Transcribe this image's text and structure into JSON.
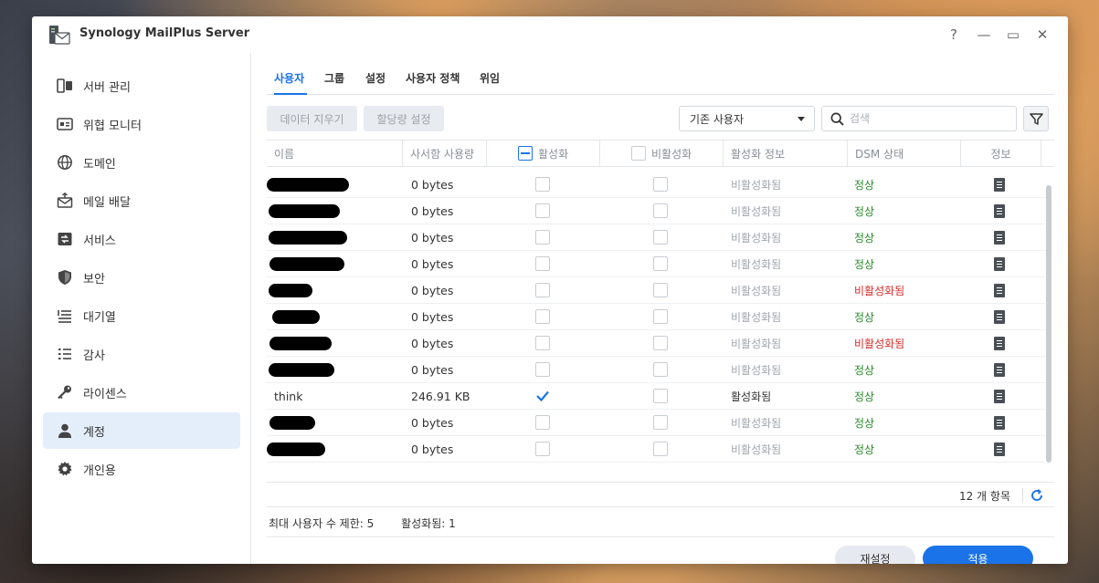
{
  "app": {
    "title": "Synology MailPlus Server"
  },
  "window_controls": {
    "help": "?",
    "minimize": "—",
    "maximize": "▭",
    "close": "✕"
  },
  "sidebar": {
    "items": [
      {
        "label": "서버 관리",
        "icon": "server-icon"
      },
      {
        "label": "위협 모니터",
        "icon": "monitor-icon"
      },
      {
        "label": "도메인",
        "icon": "globe-icon"
      },
      {
        "label": "메일 배달",
        "icon": "mail-delivery-icon"
      },
      {
        "label": "서비스",
        "icon": "service-icon"
      },
      {
        "label": "보안",
        "icon": "shield-icon"
      },
      {
        "label": "대기열",
        "icon": "queue-icon"
      },
      {
        "label": "감사",
        "icon": "audit-icon"
      },
      {
        "label": "라이센스",
        "icon": "key-icon"
      },
      {
        "label": "계정",
        "icon": "user-icon",
        "active": true
      },
      {
        "label": "개인용",
        "icon": "gear-icon"
      }
    ]
  },
  "tabs": [
    {
      "label": "사용자",
      "active": true
    },
    {
      "label": "그룹"
    },
    {
      "label": "설정"
    },
    {
      "label": "사용자 정책"
    },
    {
      "label": "위임"
    }
  ],
  "toolbar": {
    "clear_data": "데이터 지우기",
    "quota_settings": "할당량 설정",
    "filter_select": "기존 사용자",
    "search_placeholder": "검색"
  },
  "table": {
    "columns": {
      "name": "이름",
      "mailbox_usage": "사서함 사용량",
      "enable": "활성화",
      "disable": "비활성화",
      "activation_info": "활성화 정보",
      "dsm_status": "DSM 상태",
      "info": "정보"
    },
    "rows": [
      {
        "name": "",
        "redacted": true,
        "usage": "0 bytes",
        "enabled": false,
        "disabled": false,
        "activation": "비활성화됨",
        "active": false,
        "dsm": "정상",
        "dsm_ok": true
      },
      {
        "name": "",
        "redacted": true,
        "usage": "0 bytes",
        "enabled": false,
        "disabled": false,
        "activation": "비활성화됨",
        "active": false,
        "dsm": "정상",
        "dsm_ok": true
      },
      {
        "name": "",
        "redacted": true,
        "usage": "0 bytes",
        "enabled": false,
        "disabled": false,
        "activation": "비활성화됨",
        "active": false,
        "dsm": "정상",
        "dsm_ok": true
      },
      {
        "name": "",
        "redacted": true,
        "usage": "0 bytes",
        "enabled": false,
        "disabled": false,
        "activation": "비활성화됨",
        "active": false,
        "dsm": "정상",
        "dsm_ok": true
      },
      {
        "name": "",
        "redacted": true,
        "usage": "0 bytes",
        "enabled": false,
        "disabled": false,
        "activation": "비활성화됨",
        "active": false,
        "dsm": "비활성화됨",
        "dsm_ok": false
      },
      {
        "name": "",
        "redacted": true,
        "usage": "0 bytes",
        "enabled": false,
        "disabled": false,
        "activation": "비활성화됨",
        "active": false,
        "dsm": "정상",
        "dsm_ok": true
      },
      {
        "name": "",
        "redacted": true,
        "usage": "0 bytes",
        "enabled": false,
        "disabled": false,
        "activation": "비활성화됨",
        "active": false,
        "dsm": "비활성화됨",
        "dsm_ok": false
      },
      {
        "name": "",
        "redacted": true,
        "usage": "0 bytes",
        "enabled": false,
        "disabled": false,
        "activation": "비활성화됨",
        "active": false,
        "dsm": "정상",
        "dsm_ok": true
      },
      {
        "name": "think",
        "redacted": false,
        "usage": "246.91 KB",
        "enabled": true,
        "disabled": false,
        "activation": "활성화됨",
        "active": true,
        "dsm": "정상",
        "dsm_ok": true
      },
      {
        "name": "",
        "redacted": true,
        "usage": "0 bytes",
        "enabled": false,
        "disabled": false,
        "activation": "비활성화됨",
        "active": false,
        "dsm": "정상",
        "dsm_ok": true
      },
      {
        "name": "",
        "redacted": true,
        "usage": "0 bytes",
        "enabled": false,
        "disabled": false,
        "activation": "비활성화됨",
        "active": false,
        "dsm": "정상",
        "dsm_ok": true
      }
    ]
  },
  "pagination": {
    "count_label": "12 개 항목"
  },
  "footer": {
    "max_users": "최대 사용자 수 제한: 5",
    "activated": "활성화됨: 1",
    "reset": "재설정",
    "apply": "적용"
  },
  "colors": {
    "accent": "#1a73e8",
    "ok": "#2b8a2b",
    "bad": "#d62c2c"
  }
}
